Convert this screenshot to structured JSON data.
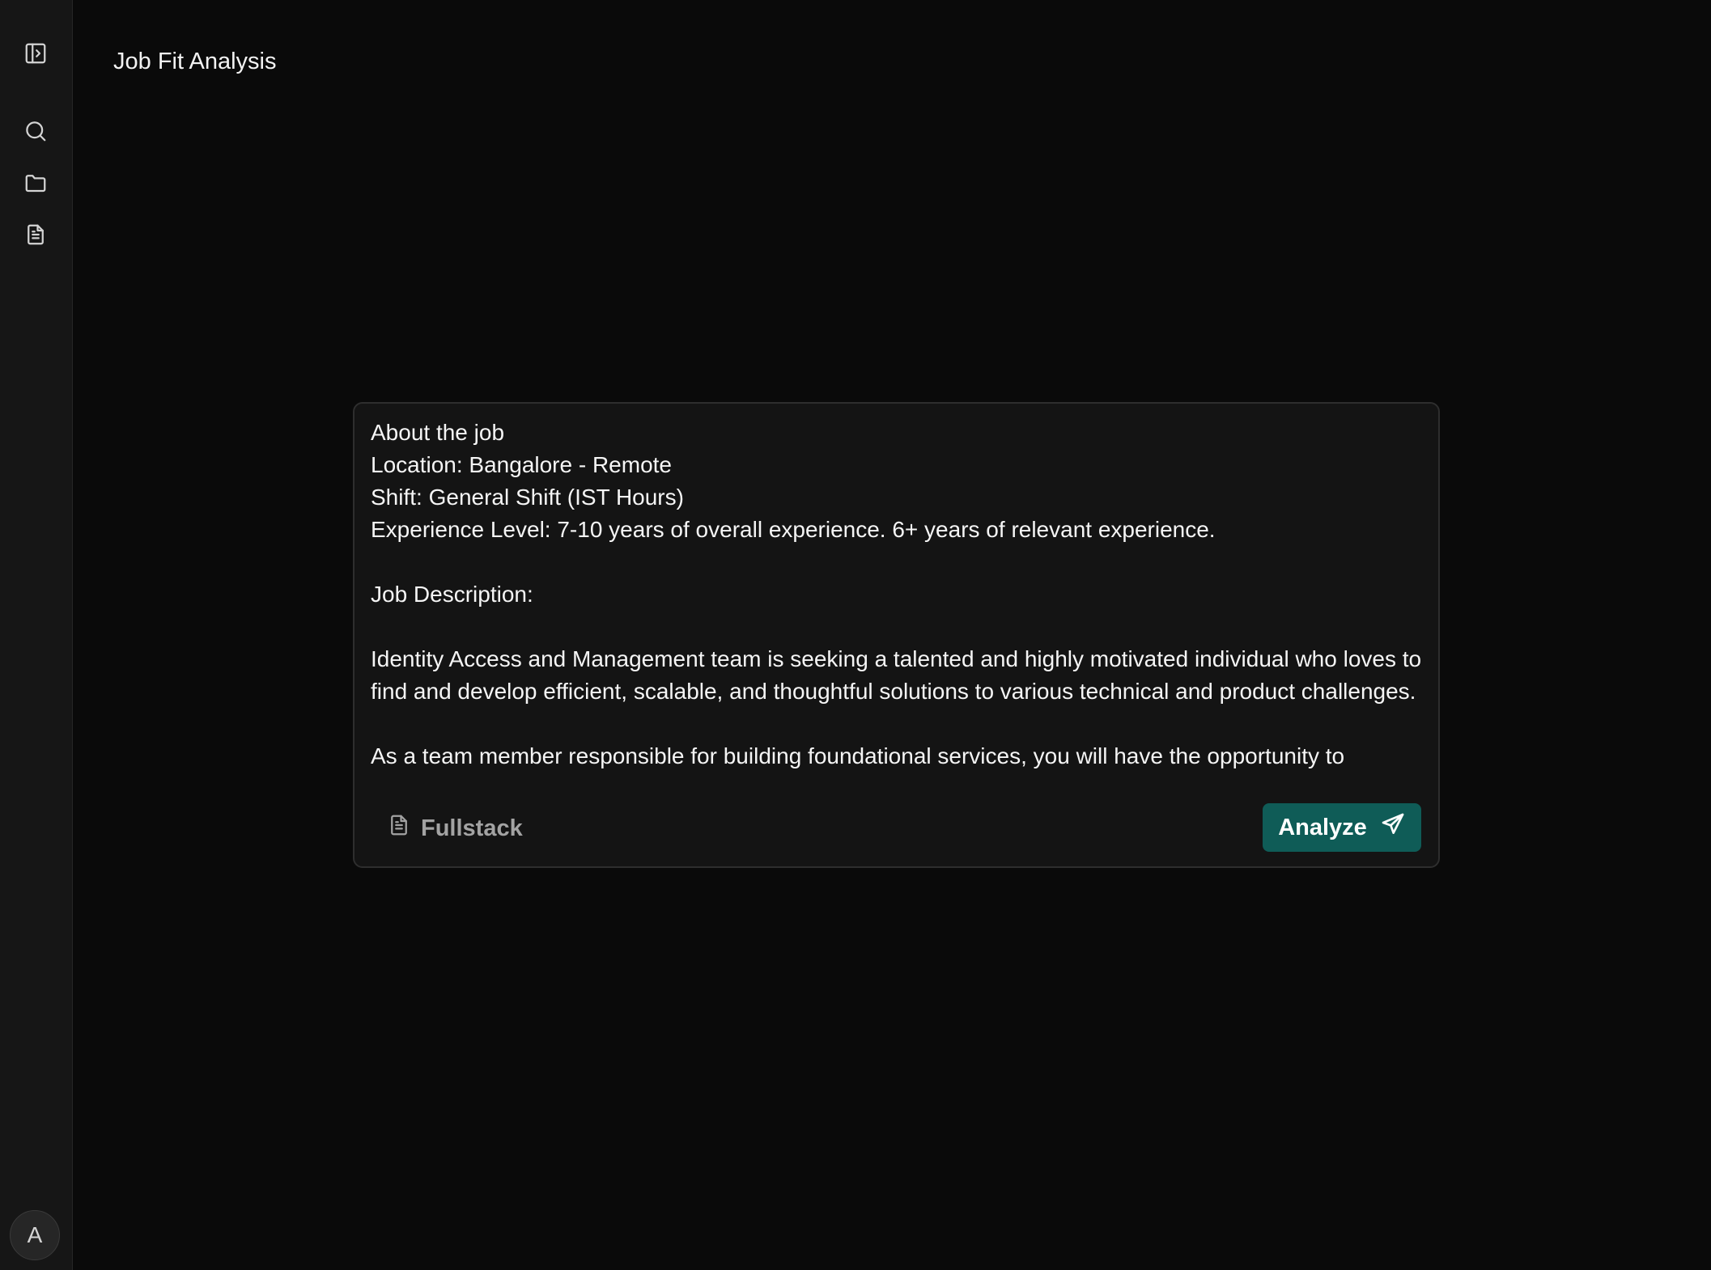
{
  "page": {
    "title": "Job Fit Analysis"
  },
  "sidebar": {
    "items": [
      {
        "icon": "sidebar-toggle-icon"
      },
      {
        "icon": "search-icon"
      },
      {
        "icon": "folder-icon"
      },
      {
        "icon": "document-icon"
      }
    ],
    "avatar_initial": "A"
  },
  "composer": {
    "job_text": "About the job\nLocation: Bangalore - Remote\nShift: General Shift (IST Hours)\nExperience Level: 7-10 years of overall experience. 6+ years of relevant experience.\n\nJob Description:\n\nIdentity Access and Management team is seeking a talented and highly motivated individual who loves to find and develop efficient, scalable, and thoughtful solutions to various technical and product challenges.\n\nAs a team member responsible for building foundational services, you will have the opportunity to",
    "resume_chip_label": "Fullstack",
    "resume_chip_icon": "document-icon",
    "analyze_label": "Analyze",
    "analyze_icon": "send-icon"
  },
  "colors": {
    "background": "#0a0a0a",
    "sidebar": "#161616",
    "card": "#141414",
    "accent": "#0f5c57"
  }
}
